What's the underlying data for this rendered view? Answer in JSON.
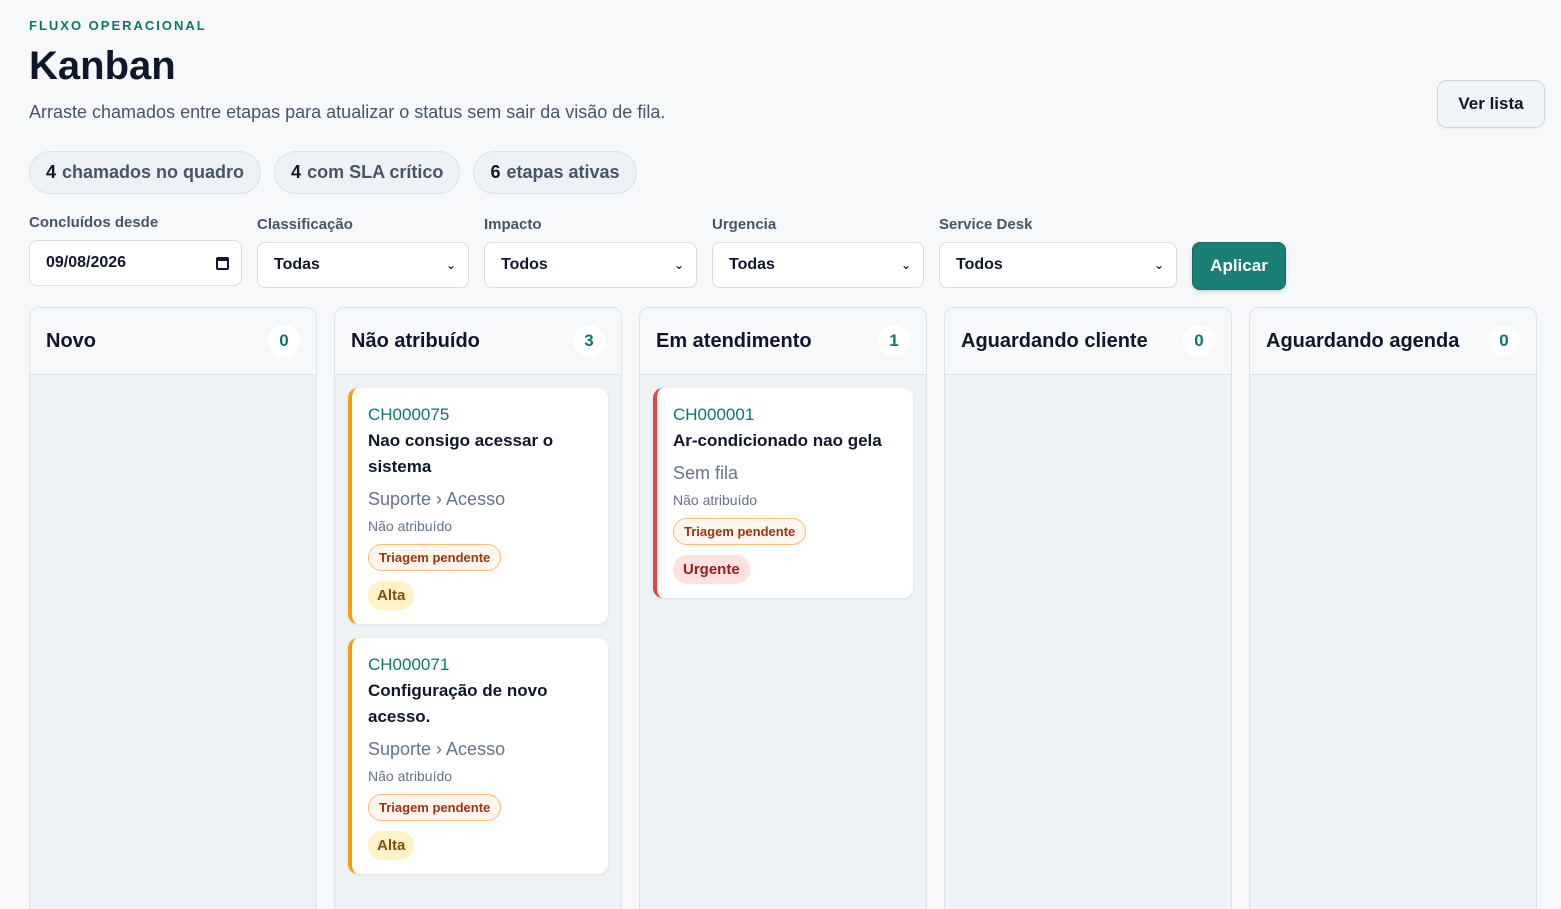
{
  "header": {
    "eyebrow": "FLUXO OPERACIONAL",
    "title": "Kanban",
    "subtitle": "Arraste chamados entre etapas para atualizar o status sem sair da visão de fila.",
    "list_button": "Ver lista"
  },
  "stats": [
    {
      "value": "4",
      "label": "chamados no quadro"
    },
    {
      "value": "4",
      "label": "com SLA crítico"
    },
    {
      "value": "6",
      "label": "etapas ativas"
    }
  ],
  "filters": {
    "concluded_since": {
      "label": "Concluídos desde",
      "value": "09/08/2026"
    },
    "classificacao": {
      "label": "Classificação",
      "value": "Todas"
    },
    "impacto": {
      "label": "Impacto",
      "value": "Todos"
    },
    "urgencia": {
      "label": "Urgencia",
      "value": "Todas"
    },
    "service_desk": {
      "label": "Service Desk",
      "value": "Todos"
    },
    "apply_label": "Aplicar"
  },
  "columns": [
    {
      "title": "Novo",
      "count": "0",
      "cards": []
    },
    {
      "title": "Não atribuído",
      "count": "3",
      "cards": [
        {
          "code": "CH000075",
          "name": "Nao consigo acessar o sistema",
          "path": "Suporte › Acesso",
          "assignee": "Não atribuído",
          "triage": "Triagem pendente",
          "priority": "Alta"
        },
        {
          "code": "CH000071",
          "name": "Configuração de novo acesso.",
          "path": "Suporte › Acesso",
          "assignee": "Não atribuído",
          "triage": "Triagem pendente",
          "priority": "Alta"
        }
      ]
    },
    {
      "title": "Em atendimento",
      "count": "1",
      "cards": [
        {
          "code": "CH000001",
          "name": "Ar-condicionado nao gela",
          "path": "Sem fila",
          "assignee": "Não atribuído",
          "triage": "Triagem pendente",
          "priority": "Urgente"
        }
      ]
    },
    {
      "title": "Aguardando cliente",
      "count": "0",
      "cards": []
    },
    {
      "title": "Aguardando agenda",
      "count": "0",
      "cards": []
    }
  ],
  "colors": {
    "accent": "#0f766e",
    "apply_button": "#1a7f74",
    "priority_alta_border": "#f59e0b",
    "priority_urgente_border": "#e04848"
  }
}
